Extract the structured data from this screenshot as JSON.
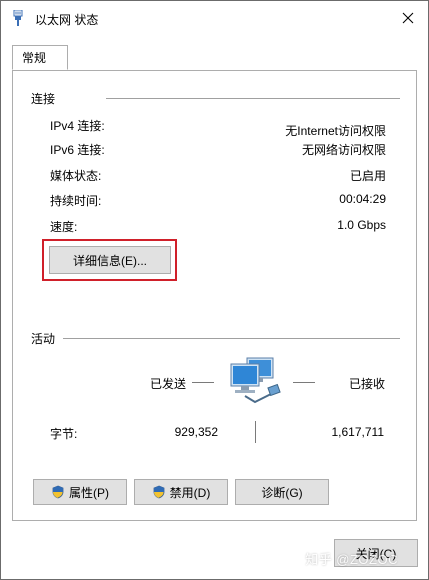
{
  "window": {
    "title": "以太网 状态"
  },
  "tabs": [
    {
      "label": "常规"
    }
  ],
  "connection": {
    "section_title": "连接",
    "rows": [
      {
        "label": "IPv4 连接:",
        "value": "无Internet访问权限"
      },
      {
        "label": "IPv6 连接:",
        "value": "无网络访问权限"
      },
      {
        "label": "媒体状态:",
        "value": "已启用"
      },
      {
        "label": "持续时间:",
        "value": "00:04:29"
      },
      {
        "label": "速度:",
        "value": "1.0 Gbps"
      }
    ],
    "details_button": "详细信息(E)..."
  },
  "activity": {
    "section_title": "活动",
    "sent_label": "已发送",
    "received_label": "已接收",
    "bytes_label": "字节:",
    "bytes_sent": "929,352",
    "bytes_received": "1,617,711"
  },
  "buttons": {
    "properties": "属性(P)",
    "disable": "禁用(D)",
    "diagnose": "诊断(G)",
    "close": "关闭(C)"
  },
  "watermark": "知乎 @ZOZOC",
  "colors": {
    "highlight_border": "#d0202a",
    "button_face": "#e1e1e1",
    "border": "#adadad"
  },
  "icons": {
    "title": "network-cable-icon",
    "close": "close-icon",
    "activity": "network-computers-icon",
    "shield": "uac-shield-icon"
  }
}
